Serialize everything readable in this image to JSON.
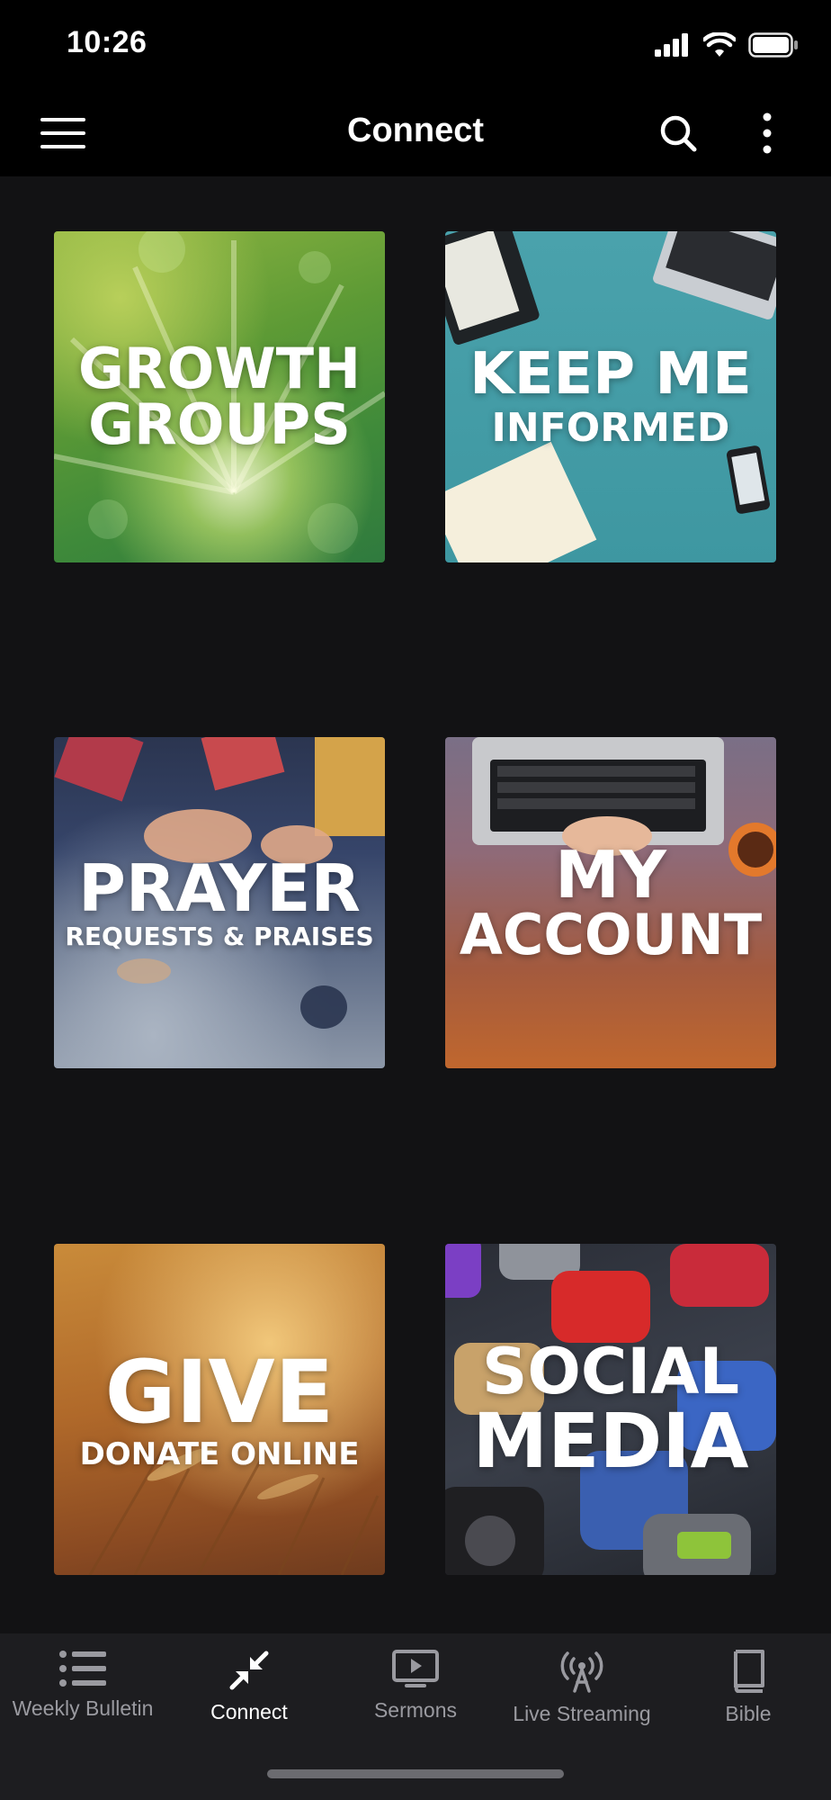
{
  "status_bar": {
    "time": "10:26"
  },
  "app_bar": {
    "title": "Connect"
  },
  "tiles": [
    {
      "line1": "GROWTH",
      "line2": "GROUPS"
    },
    {
      "line1": "KEEP ME",
      "line2": "INFORMED"
    },
    {
      "line1": "PRAYER",
      "line2": "REQUESTS & PRAISES"
    },
    {
      "line1": "MY",
      "line2": "ACCOUNT"
    },
    {
      "line1": "GIVE",
      "line2": "DONATE ONLINE"
    },
    {
      "line1": "SOCIAL",
      "line2": "MEDIA"
    }
  ],
  "bottom_nav": {
    "items": [
      {
        "label": "Weekly Bulletin",
        "icon": "list-icon",
        "active": false
      },
      {
        "label": "Connect",
        "icon": "connect-arrows-icon",
        "active": true
      },
      {
        "label": "Sermons",
        "icon": "play-screen-icon",
        "active": false
      },
      {
        "label": "Live Streaming",
        "icon": "broadcast-antenna-icon",
        "active": false
      },
      {
        "label": "Bible",
        "icon": "book-icon",
        "active": false
      }
    ]
  },
  "colors": {
    "background": "#121214",
    "top_bar": "#000000",
    "bottom_nav": "#1d1d20",
    "nav_inactive": "#9a9aa0",
    "nav_active": "#ffffff"
  }
}
